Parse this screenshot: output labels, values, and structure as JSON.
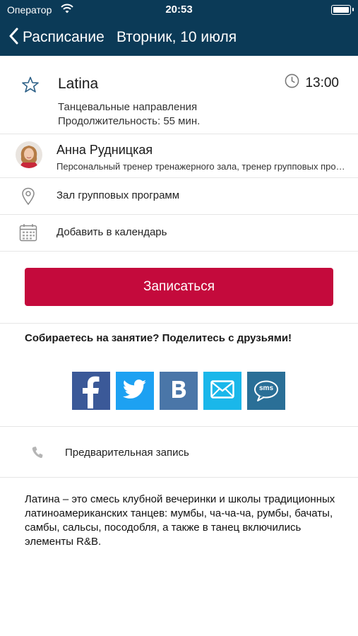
{
  "status_bar": {
    "carrier": "Оператор",
    "time": "20:53"
  },
  "nav": {
    "back_label": "Расписание",
    "title": "Вторник, 10 июля"
  },
  "class_info": {
    "name": "Latina",
    "time": "13:00",
    "category": "Танцевальные направления",
    "duration": "Продолжительность: 55 мин."
  },
  "trainer": {
    "name": "Анна Рудницкая",
    "role": "Персональный тренер тренажерного зала, тренер групповых программ"
  },
  "location": {
    "label": "Зал групповых программ"
  },
  "calendar": {
    "label": "Добавить в календарь"
  },
  "signup": {
    "label": "Записаться"
  },
  "share": {
    "title": "Собираетесь на занятие? Поделитесь с друзьями!",
    "buttons": [
      {
        "name": "facebook",
        "color": "#3b5998",
        "icon": "facebook-icon"
      },
      {
        "name": "twitter",
        "color": "#1da1f2",
        "icon": "twitter-icon"
      },
      {
        "name": "vk",
        "color": "#4a76a8",
        "icon": "vk-icon"
      },
      {
        "name": "email",
        "color": "#1ab7ea",
        "icon": "email-icon"
      },
      {
        "name": "sms",
        "color": "#2a6f97",
        "icon": "sms-icon",
        "text": "sms"
      }
    ]
  },
  "prereg": {
    "label": "Предварительная запись"
  },
  "description": {
    "text": "Латина – это смесь клубной вечеринки и школы традиционных латиноамериканских танцев: мумбы, ча-ча-ча, румбы, бачаты, самбы, сальсы, посодобля, а также в танец включились элементы R&B."
  },
  "colors": {
    "header_bg": "#0b3a57",
    "accent_red": "#c40a3c"
  }
}
